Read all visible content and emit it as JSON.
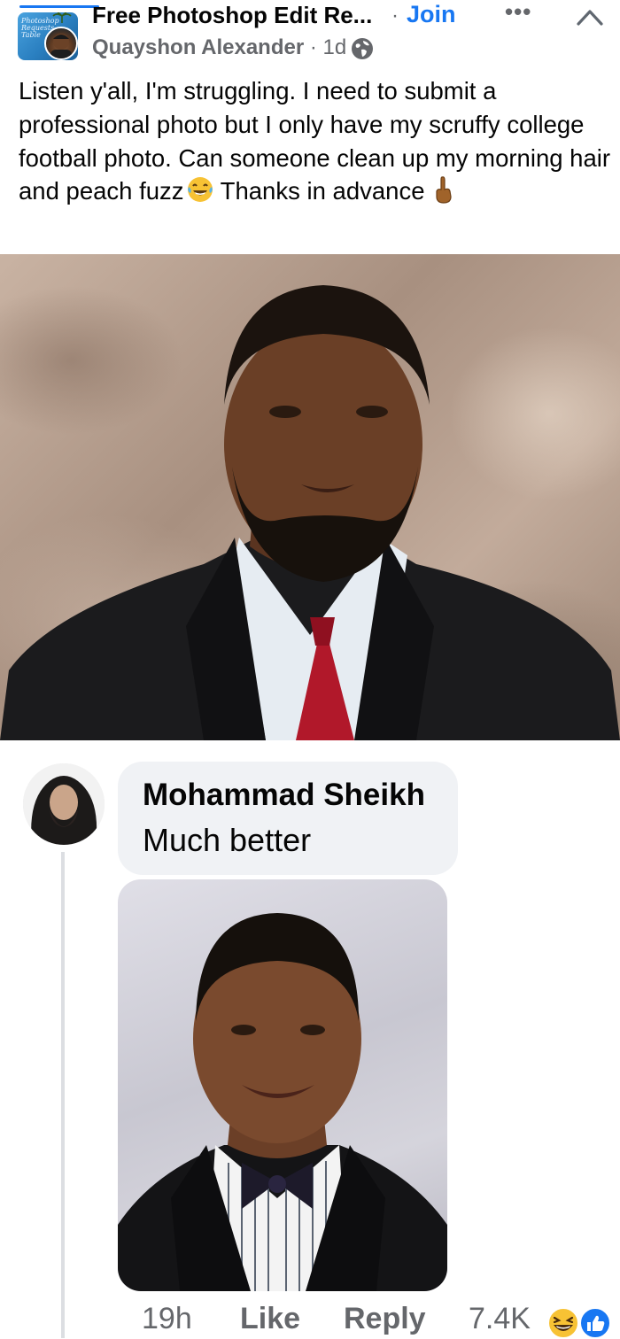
{
  "header": {
    "group_name": "Free Photoshop Edit Re...",
    "separator": "·",
    "join_label": "Join",
    "more_label": "•••",
    "group_thumb_text": "Photoshop Requests Table",
    "author_name": "Quayshon Alexander",
    "post_meta": " · 1d ·",
    "icons": [
      "more-icon",
      "close-chevron-icon",
      "globe-icon"
    ]
  },
  "post": {
    "text": "Listen y'all, I'm struggling. I need to submit a professional photo but I only have my scruffy college football photo. Can someone clean up my morning hair and peach fuzz",
    "text_after_emoji": " Thanks in advance",
    "emojis": [
      "laughing-tears-emoji",
      "crossed-fingers-emoji"
    ]
  },
  "comment": {
    "author": "Mohammad Sheikh",
    "text": "Much better",
    "time": "19h",
    "like_label": "Like",
    "reply_label": "Reply",
    "reaction_count": "7.4K",
    "reactions": [
      "haha-reaction-icon",
      "like-reaction-icon"
    ]
  },
  "colors": {
    "accent": "#1877f2",
    "secondary_text": "#65676b",
    "bubble": "#f0f2f5"
  }
}
